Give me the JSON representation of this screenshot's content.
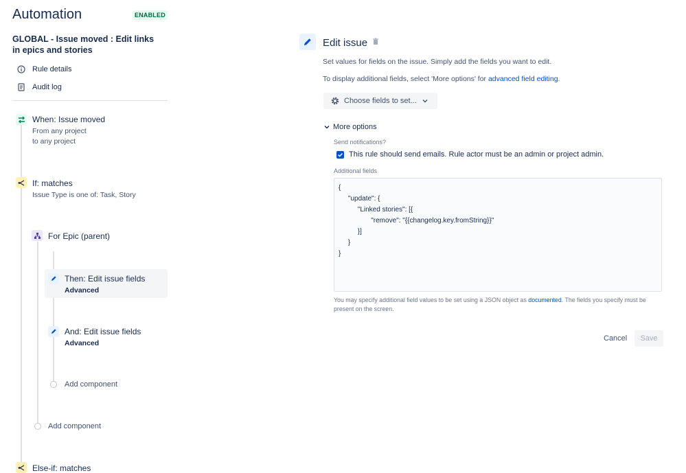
{
  "header": {
    "title": "Automation",
    "status_badge": "ENABLED"
  },
  "rule": {
    "name": "GLOBAL - Issue moved : Edit links in epics and stories"
  },
  "menu": [
    {
      "label": "Rule details",
      "icon": "info-icon"
    },
    {
      "label": "Audit log",
      "icon": "document-icon"
    }
  ],
  "flow": {
    "trigger": {
      "title": "When: Issue moved",
      "sub1": "From any project",
      "sub2": "to any project",
      "icon": "transfer-icon",
      "color": "#e3fcef"
    },
    "condition": {
      "title": "If: matches",
      "sub": "Issue Type is one of: Task, Story",
      "icon": "branch-icon",
      "color": "#fff0b3"
    },
    "branch": {
      "title": "For Epic (parent)",
      "icon": "hierarchy-icon",
      "color": "#eae6ff"
    },
    "action1": {
      "title": "Then: Edit issue fields",
      "sub": "Advanced",
      "icon": "pencil-icon"
    },
    "action2": {
      "title": "And: Edit issue fields",
      "sub": "Advanced",
      "icon": "pencil-icon"
    },
    "add_inner": "Add component",
    "add_outer": "Add component",
    "else": {
      "title": "Else-if: matches"
    }
  },
  "panel": {
    "title": "Edit issue",
    "desc1": "Set values for fields on the issue. Simply add the fields you want to edit.",
    "desc2_prefix": "To display additional fields, select 'More options' for ",
    "desc2_link": "advanced field editing",
    "desc2_suffix": ".",
    "choose_button": "Choose fields to set...",
    "more_options": "More options",
    "notify_label": "Send notifications?",
    "notify_checkbox": "This rule should send emails. Rule actor must be an admin or project admin.",
    "additional_label": "Additional fields",
    "json_value": "{\n     \"update\": {\n          \"Linked stories\": [{\n                 \"remove\": \"{{changelog.key.fromString}}\"\n          }]\n     }\n}",
    "help_prefix": "You may specify additional field values to be set using a JSON object as ",
    "help_link": "documented",
    "help_suffix": ". The fields you specify must be present on the screen.",
    "cancel": "Cancel",
    "save": "Save"
  },
  "colors": {
    "accent": "#0052cc",
    "text": "#172b4d",
    "muted": "#42526e"
  }
}
